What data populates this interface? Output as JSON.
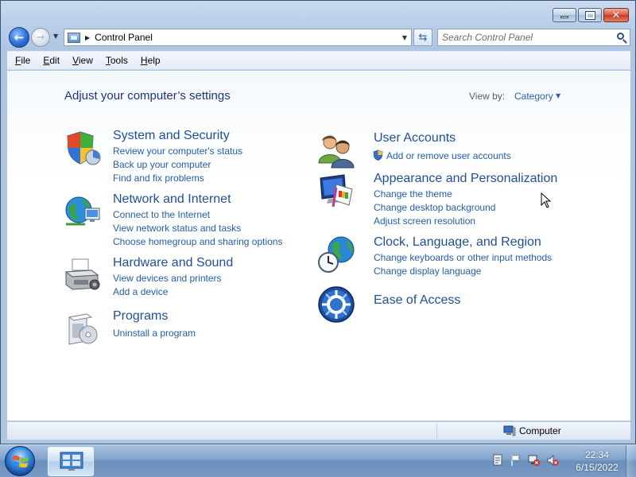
{
  "window": {
    "caption": {
      "minimize_glyph": "—",
      "maximize_glyph": "□",
      "close_glyph": "✕"
    }
  },
  "nav": {
    "back_glyph": "←",
    "forward_glyph": "→",
    "history_glyph": "▼",
    "breadcrumb_separator": "▶",
    "address_text": "Control Panel",
    "address_dropdown_glyph": "▼",
    "refresh_glyph": "⇆",
    "search_placeholder": "Search Control Panel"
  },
  "menu": {
    "items": [
      "File",
      "Edit",
      "View",
      "Tools",
      "Help"
    ]
  },
  "content": {
    "heading": "Adjust your computer’s settings",
    "view_by_label": "View by:",
    "view_by_value": "Category",
    "view_by_arrow": "▼",
    "categories_left": [
      {
        "title": "System and Security",
        "icon": "shield-icon",
        "links": [
          "Review your computer's status",
          "Back up your computer",
          "Find and fix problems"
        ]
      },
      {
        "title": "Network and Internet",
        "icon": "network-globe-icon",
        "links": [
          "Connect to the Internet",
          "View network status and tasks",
          "Choose homegroup and sharing options"
        ]
      },
      {
        "title": "Hardware and Sound",
        "icon": "printer-icon",
        "links": [
          "View devices and printers",
          "Add a device"
        ]
      },
      {
        "title": "Programs",
        "icon": "programs-disc-icon",
        "links": [
          "Uninstall a program"
        ]
      }
    ],
    "categories_right": [
      {
        "title": "User Accounts",
        "icon": "users-icon",
        "links": [
          "Add or remove user accounts"
        ]
      },
      {
        "title": "Appearance and Personalization",
        "icon": "monitor-palette-icon",
        "links": [
          "Change the theme",
          "Change desktop background",
          "Adjust screen resolution"
        ]
      },
      {
        "title": "Clock, Language, and Region",
        "icon": "globe-clock-icon",
        "links": [
          "Change keyboards or other input methods",
          "Change display language"
        ]
      },
      {
        "title": "Ease of Access",
        "icon": "ease-of-access-icon",
        "links": []
      }
    ]
  },
  "status_bar": {
    "text": "Computer"
  },
  "taskbar": {
    "clock_time": "22:34",
    "clock_date": "6/15/2022",
    "tray_icons": [
      "notification-icon",
      "flag-icon",
      "network-error-icon",
      "volume-muted-icon"
    ]
  },
  "colors": {
    "link": "#1f5db8",
    "category_title": "#1e4fa3",
    "heading": "#1e3287",
    "window_frame": "#b9cfe8",
    "taskbar": "#7fa2cb"
  }
}
